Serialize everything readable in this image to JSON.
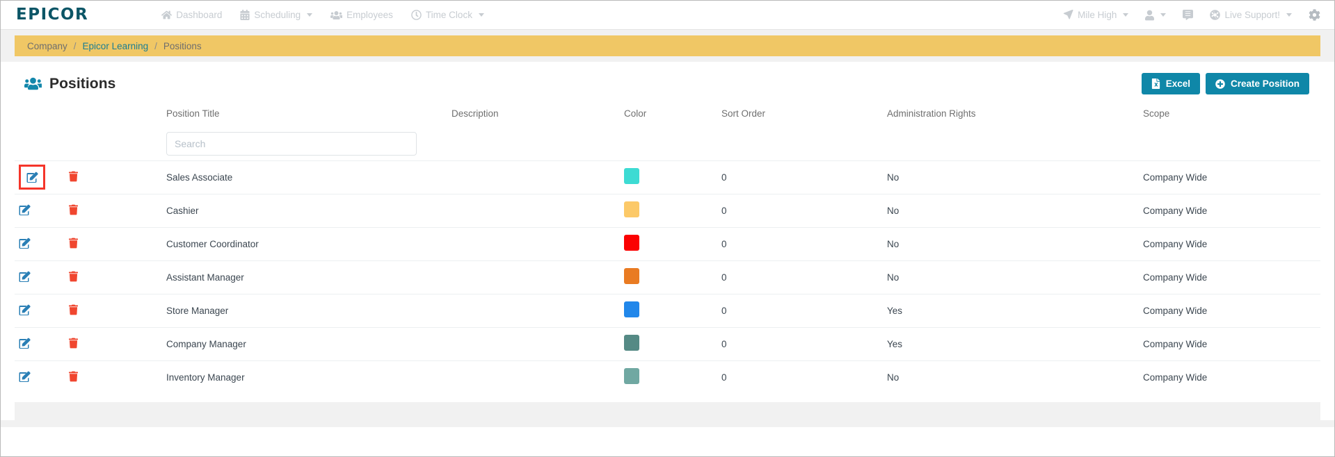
{
  "navbar": {
    "brand": "EPICOR",
    "left_items": [
      {
        "label": "Dashboard",
        "icon": "home-icon",
        "caret": false
      },
      {
        "label": "Scheduling",
        "icon": "calendar-icon",
        "caret": true
      },
      {
        "label": "Employees",
        "icon": "users-icon",
        "caret": false
      },
      {
        "label": "Time Clock",
        "icon": "clock-icon",
        "caret": true
      }
    ],
    "right_items": [
      {
        "label": "Mile High",
        "icon": "location-arrow-icon",
        "caret": true
      },
      {
        "label": "",
        "icon": "user-icon",
        "caret": true
      },
      {
        "label": "",
        "icon": "comment-icon",
        "caret": false
      },
      {
        "label": "Live Support!",
        "icon": "lifebuoy-icon",
        "caret": true
      },
      {
        "label": "",
        "icon": "gear-icon",
        "caret": false
      }
    ]
  },
  "breadcrumb": {
    "items": [
      {
        "label": "Company",
        "type": "plain"
      },
      {
        "label": "Epicor Learning",
        "type": "link"
      },
      {
        "label": "Positions",
        "type": "current"
      }
    ],
    "separator": "/",
    "background": "#f0c765"
  },
  "header": {
    "title": "Positions",
    "title_icon": "users-group-icon",
    "excel_button": {
      "label": "Excel",
      "icon": "file-excel-icon"
    },
    "create_button": {
      "label": "Create Position",
      "icon": "plus-circle-icon"
    },
    "accent_color": "#0f87a8"
  },
  "search": {
    "placeholder": "Search",
    "value": ""
  },
  "table": {
    "columns": [
      "",
      "",
      "Position Title",
      "Description",
      "Color",
      "Sort Order",
      "Administration Rights",
      "Scope"
    ],
    "rows": [
      {
        "edit_icon": "edit-icon",
        "delete_icon": "trash-icon",
        "title": "Sales Associate",
        "description": "",
        "color": "#3ddbd3",
        "sort_order": "0",
        "admin_rights": "No",
        "scope": "Company Wide",
        "highlighted": true
      },
      {
        "edit_icon": "edit-icon",
        "delete_icon": "trash-icon",
        "title": "Cashier",
        "description": "",
        "color": "#fcc968",
        "sort_order": "0",
        "admin_rights": "No",
        "scope": "Company Wide",
        "highlighted": false
      },
      {
        "edit_icon": "edit-icon",
        "delete_icon": "trash-icon",
        "title": "Customer Coordinator",
        "description": "",
        "color": "#fb0202",
        "sort_order": "0",
        "admin_rights": "No",
        "scope": "Company Wide",
        "highlighted": false
      },
      {
        "edit_icon": "edit-icon",
        "delete_icon": "trash-icon",
        "title": "Assistant Manager",
        "description": "",
        "color": "#e97b22",
        "sort_order": "0",
        "admin_rights": "No",
        "scope": "Company Wide",
        "highlighted": false
      },
      {
        "edit_icon": "edit-icon",
        "delete_icon": "trash-icon",
        "title": "Store Manager",
        "description": "",
        "color": "#2187ea",
        "sort_order": "0",
        "admin_rights": "Yes",
        "scope": "Company Wide",
        "highlighted": false
      },
      {
        "edit_icon": "edit-icon",
        "delete_icon": "trash-icon",
        "title": "Company Manager",
        "description": "",
        "color": "#558a85",
        "sort_order": "0",
        "admin_rights": "Yes",
        "scope": "Company Wide",
        "highlighted": false
      },
      {
        "edit_icon": "edit-icon",
        "delete_icon": "trash-icon",
        "title": "Inventory Manager",
        "description": "",
        "color": "#70a8a2",
        "sort_order": "0",
        "admin_rights": "No",
        "scope": "Company Wide",
        "highlighted": false
      }
    ]
  }
}
